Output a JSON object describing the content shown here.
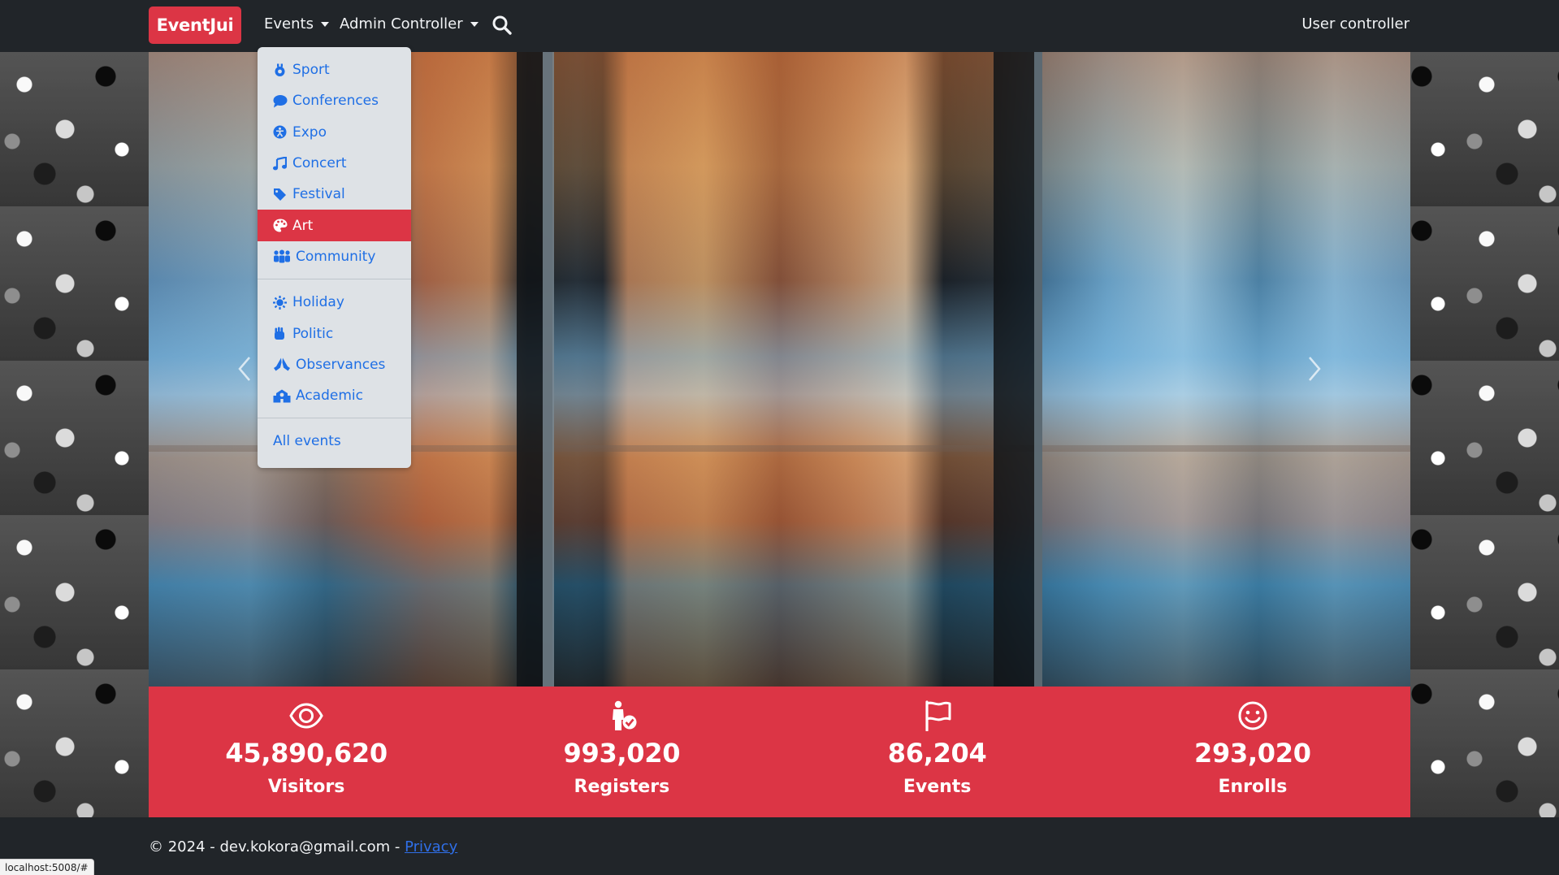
{
  "navbar": {
    "brand": "EventJui",
    "events_label": "Events",
    "admin_label": "Admin Controller",
    "user_label": "User controller"
  },
  "dropdown": {
    "items": [
      {
        "label": "Sport",
        "icon": "sport-icon",
        "active": false
      },
      {
        "label": "Conferences",
        "icon": "comment-icon",
        "active": false
      },
      {
        "label": "Expo",
        "icon": "accessibility-icon",
        "active": false
      },
      {
        "label": "Concert",
        "icon": "music-icon",
        "active": false
      },
      {
        "label": "Festival",
        "icon": "tag-icon",
        "active": false
      },
      {
        "label": "Art",
        "icon": "palette-icon",
        "active": true
      },
      {
        "label": "Community",
        "icon": "people-group-icon",
        "active": false
      }
    ],
    "items2": [
      {
        "label": "Holiday",
        "icon": "sun-icon"
      },
      {
        "label": "Politic",
        "icon": "hand-icon"
      },
      {
        "label": "Observances",
        "icon": "hands-praying-icon"
      },
      {
        "label": "Academic",
        "icon": "school-icon"
      }
    ],
    "all_label": "All events"
  },
  "stats": [
    {
      "value": "45,890,620",
      "label": "Visitors",
      "icon": "eye-icon"
    },
    {
      "value": "993,020",
      "label": "Registers",
      "icon": "person-check-icon"
    },
    {
      "value": "86,204",
      "label": "Events",
      "icon": "flag-icon"
    },
    {
      "value": "293,020",
      "label": "Enrolls",
      "icon": "smile-icon"
    }
  ],
  "footer": {
    "text": "© 2024 - dev.kokora@gmail.com - ",
    "privacy_label": "Privacy"
  },
  "status_url": "localhost:5008/#",
  "colors": {
    "accent": "#dc3545",
    "navbar": "#212529",
    "dropdown_bg": "#dee2e6",
    "link": "#1f6fe5"
  }
}
